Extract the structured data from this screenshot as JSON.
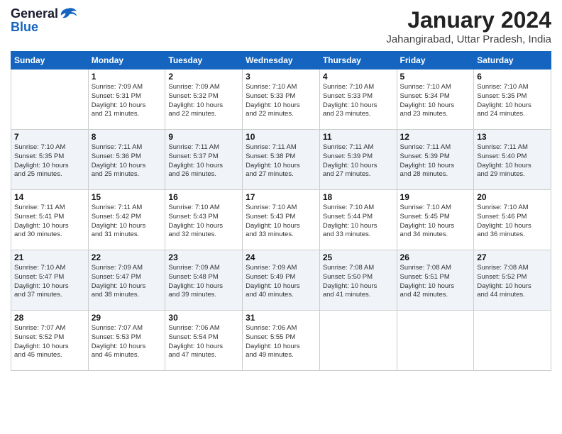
{
  "header": {
    "logo_general": "General",
    "logo_blue": "Blue",
    "month_title": "January 2024",
    "location": "Jahangirabad, Uttar Pradesh, India"
  },
  "weekdays": [
    "Sunday",
    "Monday",
    "Tuesday",
    "Wednesday",
    "Thursday",
    "Friday",
    "Saturday"
  ],
  "weeks": [
    [
      {
        "day": "",
        "info": ""
      },
      {
        "day": "1",
        "info": "Sunrise: 7:09 AM\nSunset: 5:31 PM\nDaylight: 10 hours\nand 21 minutes."
      },
      {
        "day": "2",
        "info": "Sunrise: 7:09 AM\nSunset: 5:32 PM\nDaylight: 10 hours\nand 22 minutes."
      },
      {
        "day": "3",
        "info": "Sunrise: 7:10 AM\nSunset: 5:33 PM\nDaylight: 10 hours\nand 22 minutes."
      },
      {
        "day": "4",
        "info": "Sunrise: 7:10 AM\nSunset: 5:33 PM\nDaylight: 10 hours\nand 23 minutes."
      },
      {
        "day": "5",
        "info": "Sunrise: 7:10 AM\nSunset: 5:34 PM\nDaylight: 10 hours\nand 23 minutes."
      },
      {
        "day": "6",
        "info": "Sunrise: 7:10 AM\nSunset: 5:35 PM\nDaylight: 10 hours\nand 24 minutes."
      }
    ],
    [
      {
        "day": "7",
        "info": "Sunrise: 7:10 AM\nSunset: 5:35 PM\nDaylight: 10 hours\nand 25 minutes."
      },
      {
        "day": "8",
        "info": "Sunrise: 7:11 AM\nSunset: 5:36 PM\nDaylight: 10 hours\nand 25 minutes."
      },
      {
        "day": "9",
        "info": "Sunrise: 7:11 AM\nSunset: 5:37 PM\nDaylight: 10 hours\nand 26 minutes."
      },
      {
        "day": "10",
        "info": "Sunrise: 7:11 AM\nSunset: 5:38 PM\nDaylight: 10 hours\nand 27 minutes."
      },
      {
        "day": "11",
        "info": "Sunrise: 7:11 AM\nSunset: 5:39 PM\nDaylight: 10 hours\nand 27 minutes."
      },
      {
        "day": "12",
        "info": "Sunrise: 7:11 AM\nSunset: 5:39 PM\nDaylight: 10 hours\nand 28 minutes."
      },
      {
        "day": "13",
        "info": "Sunrise: 7:11 AM\nSunset: 5:40 PM\nDaylight: 10 hours\nand 29 minutes."
      }
    ],
    [
      {
        "day": "14",
        "info": "Sunrise: 7:11 AM\nSunset: 5:41 PM\nDaylight: 10 hours\nand 30 minutes."
      },
      {
        "day": "15",
        "info": "Sunrise: 7:11 AM\nSunset: 5:42 PM\nDaylight: 10 hours\nand 31 minutes."
      },
      {
        "day": "16",
        "info": "Sunrise: 7:10 AM\nSunset: 5:43 PM\nDaylight: 10 hours\nand 32 minutes."
      },
      {
        "day": "17",
        "info": "Sunrise: 7:10 AM\nSunset: 5:43 PM\nDaylight: 10 hours\nand 33 minutes."
      },
      {
        "day": "18",
        "info": "Sunrise: 7:10 AM\nSunset: 5:44 PM\nDaylight: 10 hours\nand 33 minutes."
      },
      {
        "day": "19",
        "info": "Sunrise: 7:10 AM\nSunset: 5:45 PM\nDaylight: 10 hours\nand 34 minutes."
      },
      {
        "day": "20",
        "info": "Sunrise: 7:10 AM\nSunset: 5:46 PM\nDaylight: 10 hours\nand 36 minutes."
      }
    ],
    [
      {
        "day": "21",
        "info": "Sunrise: 7:10 AM\nSunset: 5:47 PM\nDaylight: 10 hours\nand 37 minutes."
      },
      {
        "day": "22",
        "info": "Sunrise: 7:09 AM\nSunset: 5:47 PM\nDaylight: 10 hours\nand 38 minutes."
      },
      {
        "day": "23",
        "info": "Sunrise: 7:09 AM\nSunset: 5:48 PM\nDaylight: 10 hours\nand 39 minutes."
      },
      {
        "day": "24",
        "info": "Sunrise: 7:09 AM\nSunset: 5:49 PM\nDaylight: 10 hours\nand 40 minutes."
      },
      {
        "day": "25",
        "info": "Sunrise: 7:08 AM\nSunset: 5:50 PM\nDaylight: 10 hours\nand 41 minutes."
      },
      {
        "day": "26",
        "info": "Sunrise: 7:08 AM\nSunset: 5:51 PM\nDaylight: 10 hours\nand 42 minutes."
      },
      {
        "day": "27",
        "info": "Sunrise: 7:08 AM\nSunset: 5:52 PM\nDaylight: 10 hours\nand 44 minutes."
      }
    ],
    [
      {
        "day": "28",
        "info": "Sunrise: 7:07 AM\nSunset: 5:52 PM\nDaylight: 10 hours\nand 45 minutes."
      },
      {
        "day": "29",
        "info": "Sunrise: 7:07 AM\nSunset: 5:53 PM\nDaylight: 10 hours\nand 46 minutes."
      },
      {
        "day": "30",
        "info": "Sunrise: 7:06 AM\nSunset: 5:54 PM\nDaylight: 10 hours\nand 47 minutes."
      },
      {
        "day": "31",
        "info": "Sunrise: 7:06 AM\nSunset: 5:55 PM\nDaylight: 10 hours\nand 49 minutes."
      },
      {
        "day": "",
        "info": ""
      },
      {
        "day": "",
        "info": ""
      },
      {
        "day": "",
        "info": ""
      }
    ]
  ]
}
